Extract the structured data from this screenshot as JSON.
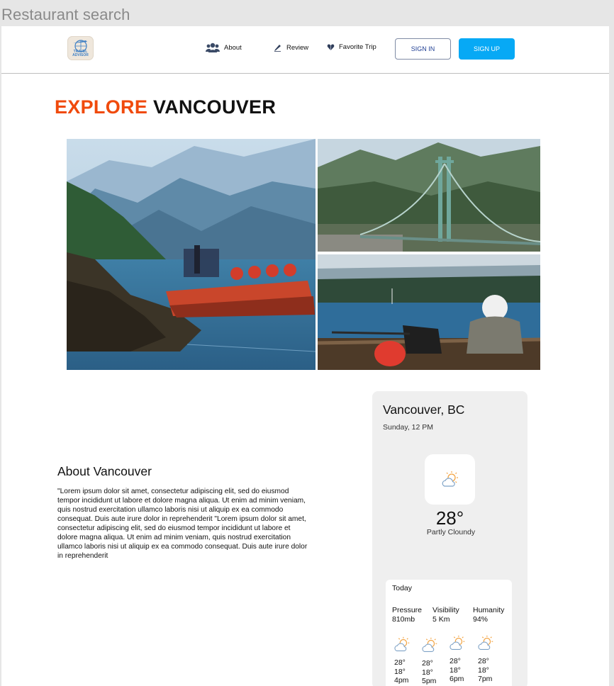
{
  "frame_title": "Restaurant search",
  "logo": {
    "text": "TRAVEL ADVISOR"
  },
  "nav": {
    "links": [
      {
        "label": "About",
        "icon": "users-icon"
      },
      {
        "label": "Review",
        "icon": "pen-icon"
      },
      {
        "label": "Favorite Trip",
        "icon": "heart-icon"
      }
    ],
    "sign_in": "SIGN IN",
    "sign_up": "SIGN UP"
  },
  "heading": {
    "accent": "EXPLORE",
    "rest": "VANCOUVER"
  },
  "about": {
    "title": "About Vancouver",
    "body": "\"Lorem ipsum dolor sit amet, consectetur adipiscing elit, sed do eiusmod tempor incididunt ut labore et dolore magna aliqua. Ut enim ad minim veniam, quis nostrud exercitation ullamco laboris nisi ut aliquip ex ea commodo consequat. Duis aute irure dolor in reprehenderit \"Lorem ipsum dolor sit amet, consectetur adipiscing elit, sed do eiusmod tempor incididunt ut labore et dolore magna aliqua. Ut enim ad minim veniam, quis nostrud exercitation ullamco laboris nisi ut aliquip ex ea commodo consequat. Duis aute irure dolor in reprehenderit"
  },
  "weather": {
    "city": "Vancouver, BC",
    "date": "Sunday, 12 PM",
    "temp": "28°",
    "condition": "Partly Cloundy",
    "today": {
      "title": "Today",
      "stats": [
        {
          "label": "Pressure",
          "value": "810mb"
        },
        {
          "label": "Visibility",
          "value": "5 Km"
        },
        {
          "label": "Humanity",
          "value": "94%"
        }
      ],
      "hours": [
        {
          "high": "28°",
          "low": "18°",
          "time": "4pm"
        },
        {
          "high": "28°",
          "low": "18°",
          "time": "5pm"
        },
        {
          "high": "28°",
          "low": "18°",
          "time": "6pm"
        },
        {
          "high": "28°",
          "low": "18°",
          "time": "7pm"
        }
      ]
    }
  },
  "colors": {
    "accent": "#f04a0c",
    "primary": "#07a9f5",
    "sign_in_text": "#1f3e93"
  }
}
